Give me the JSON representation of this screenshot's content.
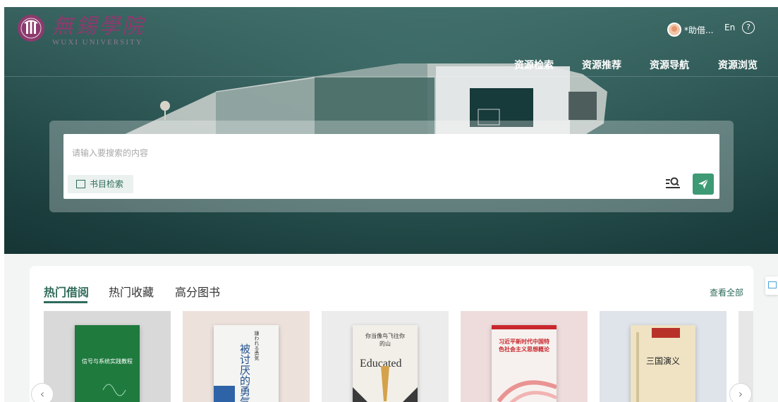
{
  "header": {
    "logo_cn": "無錫學院",
    "logo_en": "WUXI UNIVERSITY",
    "user_name": "*助借...",
    "lang_toggle": "En",
    "help_icon": "help-circle-icon"
  },
  "nav": {
    "items": [
      {
        "label": "资源检索",
        "active": true
      },
      {
        "label": "资源推荐",
        "active": false
      },
      {
        "label": "资源导航",
        "active": false
      },
      {
        "label": "资源浏览",
        "active": false
      }
    ]
  },
  "search": {
    "placeholder": "请输入要搜索的内容",
    "value": "",
    "catalog_button": "书目检索",
    "advanced_icon": "advanced-search-icon",
    "submit_icon": "send-icon",
    "accent_color": "#3d9a74"
  },
  "books_panel": {
    "tabs": [
      {
        "label": "热门借阅",
        "active": true
      },
      {
        "label": "热门收藏",
        "active": false
      },
      {
        "label": "高分图书",
        "active": false
      }
    ],
    "view_all": "查看全部",
    "books": [
      {
        "cover_title": "信号与系统实践教程",
        "cover_color": "#1f7a3e",
        "card_bg": "#d9d9d9"
      },
      {
        "cover_title": "被讨厌的勇气",
        "cover_subtitle": "嫌われる勇気",
        "cover_color": "#f4f4f2",
        "card_bg": "#ede1dc"
      },
      {
        "cover_title": "你当像鸟飞往你的山",
        "cover_subtitle": "Educated",
        "cover_color": "#f2efe8",
        "card_bg": "#ececec"
      },
      {
        "cover_title": "习近平新时代中国特色社会主义思想概论",
        "cover_color": "#f6f1ee",
        "card_bg": "#eedcdc"
      },
      {
        "cover_title": "三国演义",
        "cover_color": "#efe3c4",
        "card_bg": "#dfe3ea"
      }
    ],
    "prev_icon": "chevron-left-icon",
    "next_icon": "chevron-right-icon"
  },
  "colors": {
    "brand_green": "#2f6b5a",
    "logo_purple": "#8c3a6e"
  }
}
